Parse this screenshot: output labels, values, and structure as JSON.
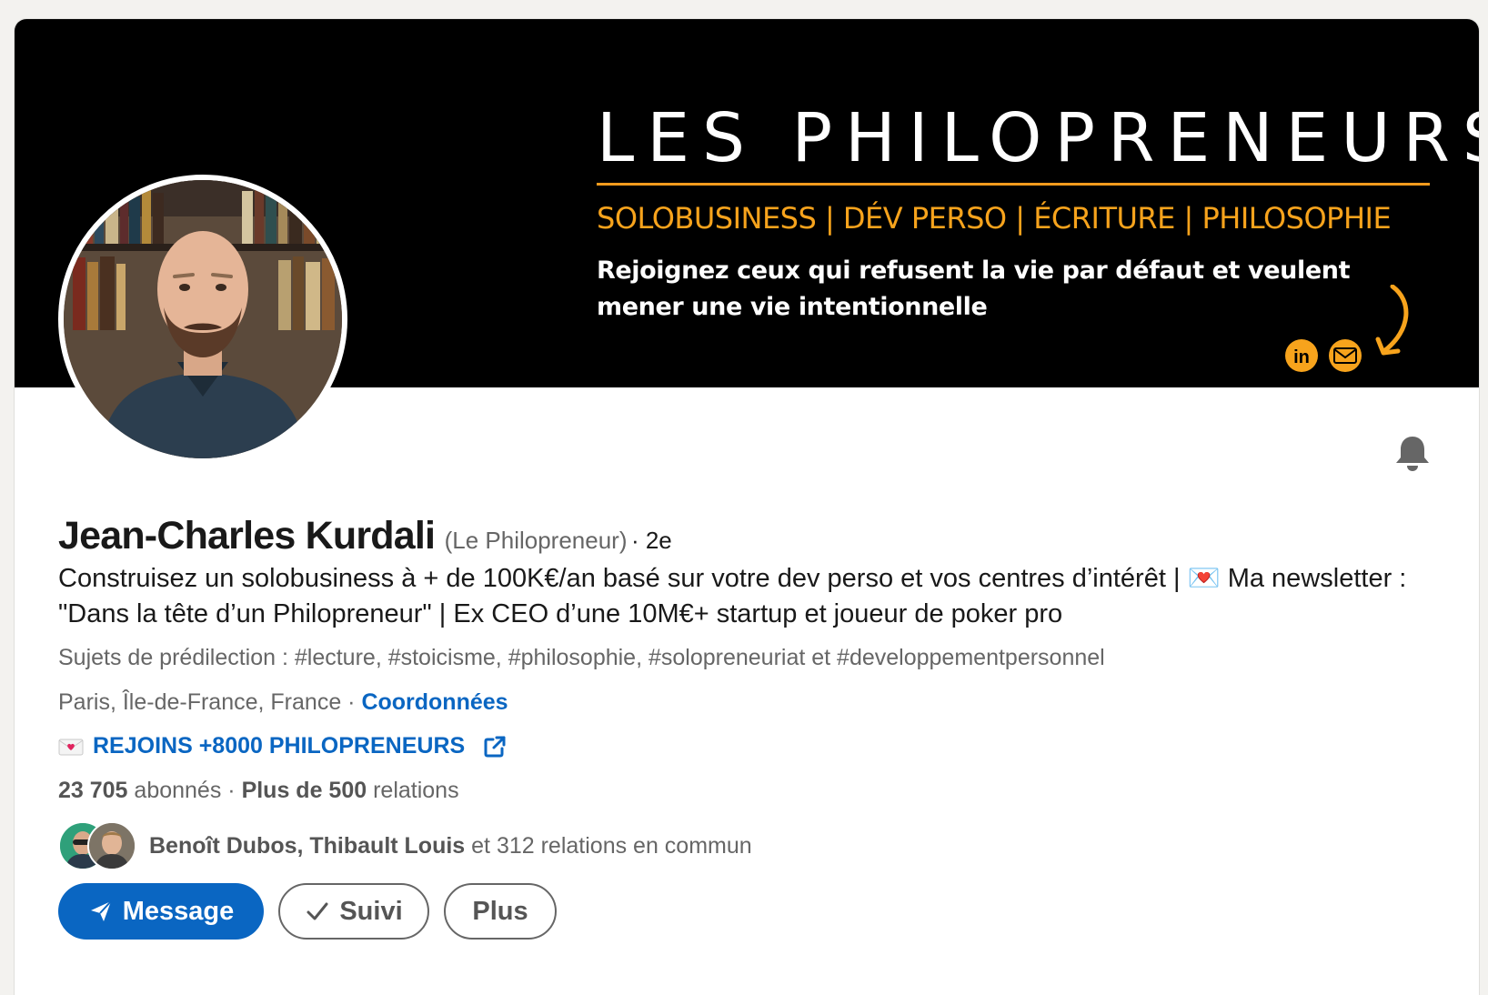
{
  "banner": {
    "title": "LES PHILOPRENEURS",
    "tagline": "SOLOBUSINESS | DÉV PERSO | ÉCRITURE | PHILOSOPHIE",
    "text": "Rejoignez ceux qui refusent la vie par défaut et veulent mener une vie intentionnelle",
    "icons": [
      "linkedin-icon",
      "envelope-icon",
      "curved-arrow-icon"
    ],
    "accent_color": "#f7a31c"
  },
  "profile": {
    "name": "Jean-Charles Kurdali",
    "nickname": "(Le Philopreneur)",
    "degree": "· 2e",
    "headline": "Construisez un solobusiness à + de 100K€/an basé sur votre dev perso et vos centres d’intérêt | 💌 Ma newsletter : \"Dans la tête d’un Philopreneur\" | Ex CEO d’une 10M€+ startup et joueur de poker pro",
    "topics": "Sujets de prédilection : #lecture, #stoicisme, #philosophie, #solopreneuriat et #developpementpersonnel",
    "location": "Paris, Île-de-France, France",
    "location_separator": " · ",
    "contact_label": "Coordonnées",
    "website_label": "REJOINS +8000 PHILOPRENEURS",
    "followers_count": "23 705",
    "followers_label": " abonnés",
    "connections_separator": " · ",
    "connections_count": "Plus de 500",
    "connections_label": " relations",
    "mutual_names": "Benoît Dubos, Thibault Louis",
    "mutual_suffix": " et 312 relations en commun"
  },
  "actions": {
    "message_label": "Message",
    "follow_label": "Suivi",
    "more_label": "Plus"
  },
  "colors": {
    "primary": "#0a66c2",
    "banner_bg": "#000000",
    "muted_text": "#666666"
  }
}
